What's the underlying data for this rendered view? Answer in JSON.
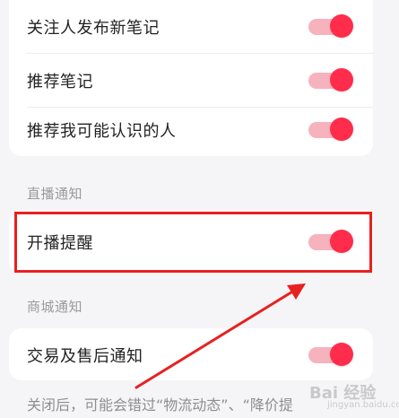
{
  "sections": {
    "top": {
      "items": [
        {
          "label": "关注人发布新笔记"
        },
        {
          "label": "推荐笔记"
        },
        {
          "label": "推荐我可能认识的人"
        }
      ]
    },
    "live": {
      "title": "直播通知",
      "items": [
        {
          "label": "开播提醒"
        }
      ]
    },
    "shop": {
      "title": "商城通知",
      "items": [
        {
          "label": "交易及售后通知"
        }
      ]
    }
  },
  "toggles": {
    "state": "on",
    "colors": {
      "track": "#f6b3bd",
      "knob": "#ff2c4b"
    }
  },
  "footer": {
    "note": "关闭后，可能会错过“物流动态”、“降价提"
  },
  "annotation": {
    "box_color": "#e82020",
    "arrow_color": "#e82020"
  },
  "watermark": {
    "text": "Bai 经验",
    "sub": "jingyan.baidu.com"
  }
}
